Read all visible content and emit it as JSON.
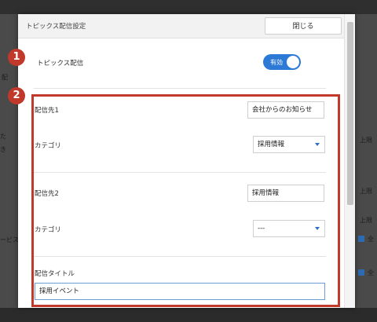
{
  "modal": {
    "title": "トピックス配信設定",
    "close_label": "閉じる"
  },
  "topics_delivery": {
    "label": "トピックス配信",
    "toggle_label": "有効",
    "enabled": true
  },
  "destinations": [
    {
      "label": "配信先1",
      "value": "会社からのお知らせ",
      "category_label": "カテゴリ",
      "category_value": "採用情報"
    },
    {
      "label": "配信先2",
      "value": "採用情報",
      "category_label": "カテゴリ",
      "category_value": "---"
    }
  ],
  "delivery_title": {
    "label": "配信タイトル",
    "value": "採用イベント"
  },
  "markers": {
    "first": "1",
    "second": "2"
  },
  "colors": {
    "accent": "#2c7ad6",
    "marker": "#c0392b"
  },
  "background_fragments": [
    "配",
    "た",
    "き",
    "上限",
    "上限",
    "上限",
    "ービス",
    "全",
    "全"
  ]
}
